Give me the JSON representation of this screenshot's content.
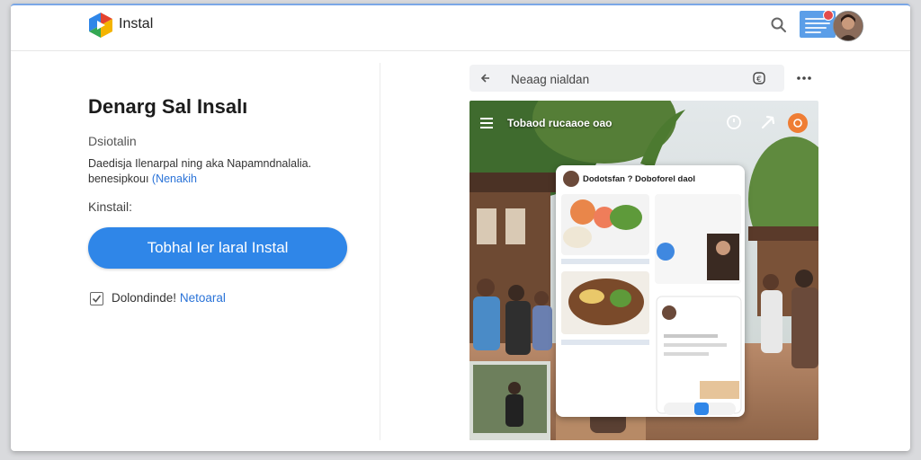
{
  "app": {
    "title": "Instal",
    "logo_icon": "play-logo-icon",
    "colors": {
      "accent": "#2f86e8",
      "link": "#2a73d8",
      "badge": "#e34b4b",
      "photo_action": "#ef7d34"
    }
  },
  "header": {
    "search_icon": "search-icon",
    "notification_icon": "notification-card-icon",
    "avatar_icon": "avatar"
  },
  "main": {
    "heading": "Denarg Sal Insalı",
    "subheading": "Dsiotalin",
    "description": "Daedisja Ilenarpal ning aka Napamndnalalia. benesipkouı",
    "description_link": "(Nenakih",
    "field_label": "Kinstail:",
    "cta_label": "Tobhal Ier laral Instal",
    "consent_text": "Dolondinde!",
    "consent_link": "Netoaral",
    "consent_checked": true
  },
  "preview": {
    "address_placeholder": "Neaag nialdan",
    "back_icon": "back-arrow-icon",
    "address_action_icon": "info-circle-icon",
    "more_icon": "more-dots-icon",
    "photo_caption": "Tobaod rucaaoe oao",
    "feed_title": "Dodotsfan ? Doboforel daol",
    "photo_icons": [
      "menu-icon",
      "timer-icon",
      "share-icon",
      "orange-action-icon"
    ]
  }
}
